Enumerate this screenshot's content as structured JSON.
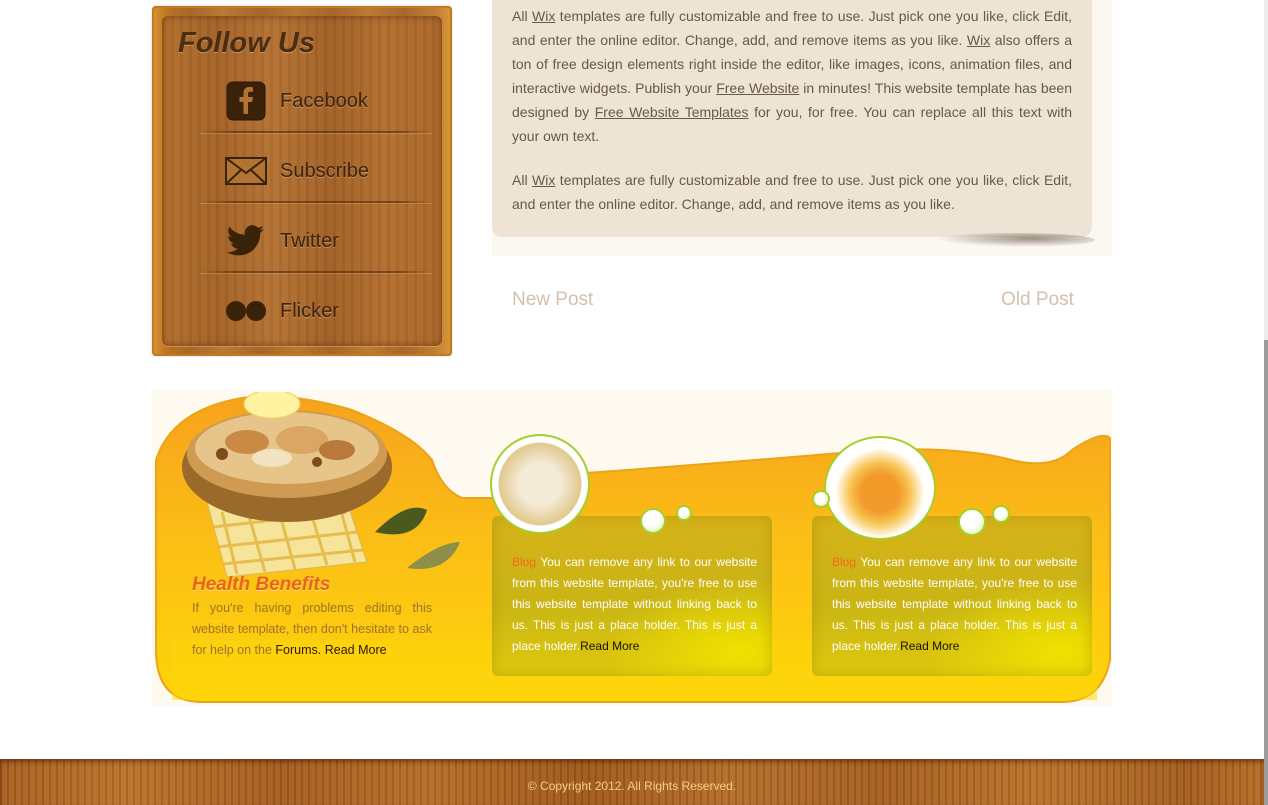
{
  "follow": {
    "title": "Follow Us",
    "items": [
      {
        "label": "Facebook",
        "icon": "facebook-icon"
      },
      {
        "label": "Subscribe",
        "icon": "mail-icon"
      },
      {
        "label": "Twitter",
        "icon": "twitter-icon"
      },
      {
        "label": "Flicker",
        "icon": "flickr-icon"
      }
    ]
  },
  "article": {
    "p1": {
      "t1": "All ",
      "link1": "Wix",
      "t2": " templates are fully customizable and free to use. Just pick one you like, click Edit, and enter the online editor. Change, add, and remove items as you like. ",
      "link2": "Wix",
      "t3": " also offers a ton of free design elements right inside the editor, like images, icons, animation files, and interactive widgets. Publish your ",
      "link3": "Free Website",
      "t4": " in minutes! This website template has been designed by ",
      "link4": "Free Website Templates",
      "t5": " for you, for free. You can replace all this text with your own text."
    },
    "p2": {
      "t1": "All ",
      "link1": "Wix",
      "t2": " templates are fully customizable and free to use. Just pick one you like, click Edit, and enter the online editor. Change, add, and remove items as you like."
    }
  },
  "post_nav": {
    "new": "New Post",
    "old": "Old Post"
  },
  "features": {
    "health": {
      "title": "Health Benefits",
      "text": "If you're having problems editing this website template, then don't hesitate to ask for help on the ",
      "forums": "Forums",
      "dot": ".",
      "read_more": "Read More"
    },
    "blogs": [
      {
        "tag": "Blog",
        "text": " You can remove any link to our website from this website template, you're free to use this website template without linking back to us. This is just a place holder. This is just a place holder.",
        "read_more": "Read More"
      },
      {
        "tag": "Blog",
        "text": " You can remove any link to our website from this website template, you're free to use this website template without linking back to us. This is just a place holder. This is just a place holder.",
        "read_more": "Read More"
      }
    ]
  },
  "footer": {
    "copyright": "© Copyright 2012. All Rights Reserved."
  },
  "colors": {
    "accent_orange": "#e8641d",
    "band_yellow": "#fdd20a",
    "wood": "#a8652a"
  }
}
